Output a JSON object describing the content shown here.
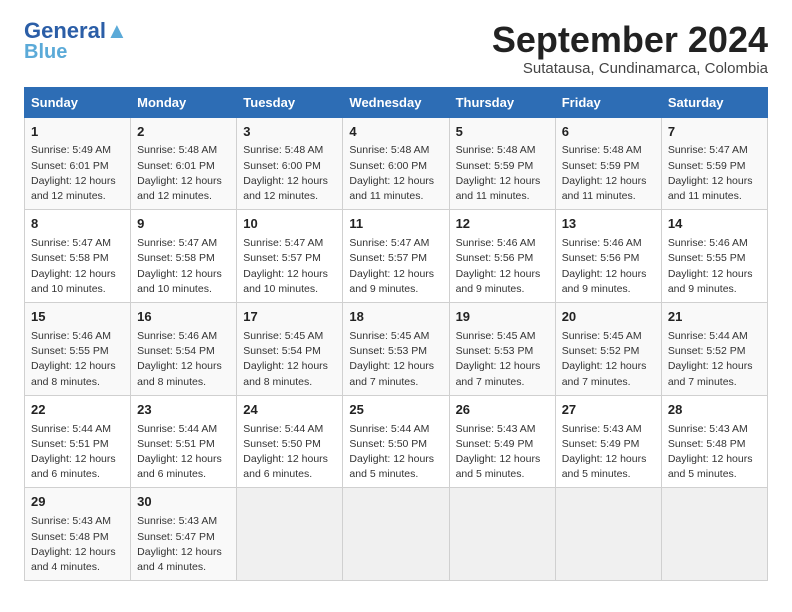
{
  "header": {
    "logo_line1": "General",
    "logo_line2": "Blue",
    "month": "September 2024",
    "location": "Sutatausa, Cundinamarca, Colombia"
  },
  "weekdays": [
    "Sunday",
    "Monday",
    "Tuesday",
    "Wednesday",
    "Thursday",
    "Friday",
    "Saturday"
  ],
  "weeks": [
    [
      {
        "day": "1",
        "sunrise": "5:49 AM",
        "sunset": "6:01 PM",
        "daylight": "12 hours and 12 minutes."
      },
      {
        "day": "2",
        "sunrise": "5:48 AM",
        "sunset": "6:01 PM",
        "daylight": "12 hours and 12 minutes."
      },
      {
        "day": "3",
        "sunrise": "5:48 AM",
        "sunset": "6:00 PM",
        "daylight": "12 hours and 12 minutes."
      },
      {
        "day": "4",
        "sunrise": "5:48 AM",
        "sunset": "6:00 PM",
        "daylight": "12 hours and 11 minutes."
      },
      {
        "day": "5",
        "sunrise": "5:48 AM",
        "sunset": "5:59 PM",
        "daylight": "12 hours and 11 minutes."
      },
      {
        "day": "6",
        "sunrise": "5:48 AM",
        "sunset": "5:59 PM",
        "daylight": "12 hours and 11 minutes."
      },
      {
        "day": "7",
        "sunrise": "5:47 AM",
        "sunset": "5:59 PM",
        "daylight": "12 hours and 11 minutes."
      }
    ],
    [
      {
        "day": "8",
        "sunrise": "5:47 AM",
        "sunset": "5:58 PM",
        "daylight": "12 hours and 10 minutes."
      },
      {
        "day": "9",
        "sunrise": "5:47 AM",
        "sunset": "5:58 PM",
        "daylight": "12 hours and 10 minutes."
      },
      {
        "day": "10",
        "sunrise": "5:47 AM",
        "sunset": "5:57 PM",
        "daylight": "12 hours and 10 minutes."
      },
      {
        "day": "11",
        "sunrise": "5:47 AM",
        "sunset": "5:57 PM",
        "daylight": "12 hours and 9 minutes."
      },
      {
        "day": "12",
        "sunrise": "5:46 AM",
        "sunset": "5:56 PM",
        "daylight": "12 hours and 9 minutes."
      },
      {
        "day": "13",
        "sunrise": "5:46 AM",
        "sunset": "5:56 PM",
        "daylight": "12 hours and 9 minutes."
      },
      {
        "day": "14",
        "sunrise": "5:46 AM",
        "sunset": "5:55 PM",
        "daylight": "12 hours and 9 minutes."
      }
    ],
    [
      {
        "day": "15",
        "sunrise": "5:46 AM",
        "sunset": "5:55 PM",
        "daylight": "12 hours and 8 minutes."
      },
      {
        "day": "16",
        "sunrise": "5:46 AM",
        "sunset": "5:54 PM",
        "daylight": "12 hours and 8 minutes."
      },
      {
        "day": "17",
        "sunrise": "5:45 AM",
        "sunset": "5:54 PM",
        "daylight": "12 hours and 8 minutes."
      },
      {
        "day": "18",
        "sunrise": "5:45 AM",
        "sunset": "5:53 PM",
        "daylight": "12 hours and 7 minutes."
      },
      {
        "day": "19",
        "sunrise": "5:45 AM",
        "sunset": "5:53 PM",
        "daylight": "12 hours and 7 minutes."
      },
      {
        "day": "20",
        "sunrise": "5:45 AM",
        "sunset": "5:52 PM",
        "daylight": "12 hours and 7 minutes."
      },
      {
        "day": "21",
        "sunrise": "5:44 AM",
        "sunset": "5:52 PM",
        "daylight": "12 hours and 7 minutes."
      }
    ],
    [
      {
        "day": "22",
        "sunrise": "5:44 AM",
        "sunset": "5:51 PM",
        "daylight": "12 hours and 6 minutes."
      },
      {
        "day": "23",
        "sunrise": "5:44 AM",
        "sunset": "5:51 PM",
        "daylight": "12 hours and 6 minutes."
      },
      {
        "day": "24",
        "sunrise": "5:44 AM",
        "sunset": "5:50 PM",
        "daylight": "12 hours and 6 minutes."
      },
      {
        "day": "25",
        "sunrise": "5:44 AM",
        "sunset": "5:50 PM",
        "daylight": "12 hours and 5 minutes."
      },
      {
        "day": "26",
        "sunrise": "5:43 AM",
        "sunset": "5:49 PM",
        "daylight": "12 hours and 5 minutes."
      },
      {
        "day": "27",
        "sunrise": "5:43 AM",
        "sunset": "5:49 PM",
        "daylight": "12 hours and 5 minutes."
      },
      {
        "day": "28",
        "sunrise": "5:43 AM",
        "sunset": "5:48 PM",
        "daylight": "12 hours and 5 minutes."
      }
    ],
    [
      {
        "day": "29",
        "sunrise": "5:43 AM",
        "sunset": "5:48 PM",
        "daylight": "12 hours and 4 minutes."
      },
      {
        "day": "30",
        "sunrise": "5:43 AM",
        "sunset": "5:47 PM",
        "daylight": "12 hours and 4 minutes."
      },
      null,
      null,
      null,
      null,
      null
    ]
  ]
}
